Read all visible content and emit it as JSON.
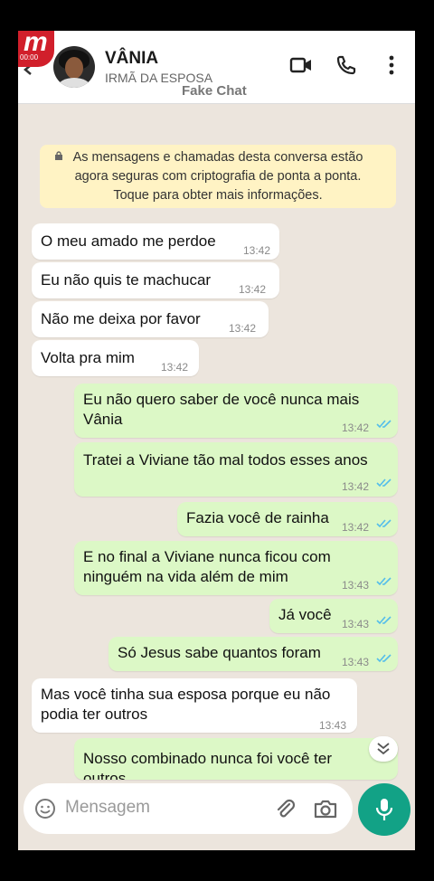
{
  "overlay": {
    "badge_letter": "m",
    "badge_time": "00:00",
    "watermark": "Fake Chat"
  },
  "contact": {
    "name": "VÂNIA",
    "subtitle": "IRMÃ DA ESPOSA"
  },
  "header_icons": [
    "video-call-icon",
    "phone-icon",
    "more-vert-icon"
  ],
  "notice": {
    "line1": "As mensagens e chamadas desta conversa estão",
    "line2": "agora seguras com criptografia de ponta a ponta.",
    "line3": "Toque para obter mais informações."
  },
  "messages": [
    {
      "dir": "in",
      "lines": [
        "O meu amado me perdoe"
      ],
      "time": "13:42"
    },
    {
      "dir": "in",
      "lines": [
        "Eu não quis te machucar"
      ],
      "time": "13:42"
    },
    {
      "dir": "in",
      "lines": [
        "Não me deixa por favor"
      ],
      "time": "13:42"
    },
    {
      "dir": "in",
      "lines": [
        "Volta pra mim"
      ],
      "time": "13:42"
    },
    {
      "dir": "out",
      "lines": [
        "Eu não quero saber de você nunca mais",
        "Vânia"
      ],
      "time": "13:42"
    },
    {
      "dir": "out",
      "lines": [
        "Tratei a Viviane tão mal todos esses anos"
      ],
      "time": "13:42"
    },
    {
      "dir": "out",
      "lines": [
        "Fazia você de rainha"
      ],
      "time": "13:42"
    },
    {
      "dir": "out",
      "lines": [
        "E no final a Viviane nunca ficou com",
        "ninguém na vida além de mim"
      ],
      "time": "13:43"
    },
    {
      "dir": "out",
      "lines": [
        "Já você"
      ],
      "time": "13:43"
    },
    {
      "dir": "out",
      "lines": [
        "Só Jesus sabe quantos foram"
      ],
      "time": "13:43"
    },
    {
      "dir": "in",
      "lines": [
        "Mas você tinha sua esposa porque eu não",
        "podia ter outros"
      ],
      "time": "13:43"
    },
    {
      "dir": "out",
      "lines": [
        "Nosso combinado nunca foi você ter",
        "outros"
      ],
      "time": ""
    }
  ],
  "composer": {
    "placeholder": "Mensagem"
  },
  "colors": {
    "incoming": "#FFFFFF",
    "outgoing": "#DCF8C6",
    "accent": "#12A286",
    "ticks": "#53BDEB",
    "background": "#ECE5DD"
  }
}
